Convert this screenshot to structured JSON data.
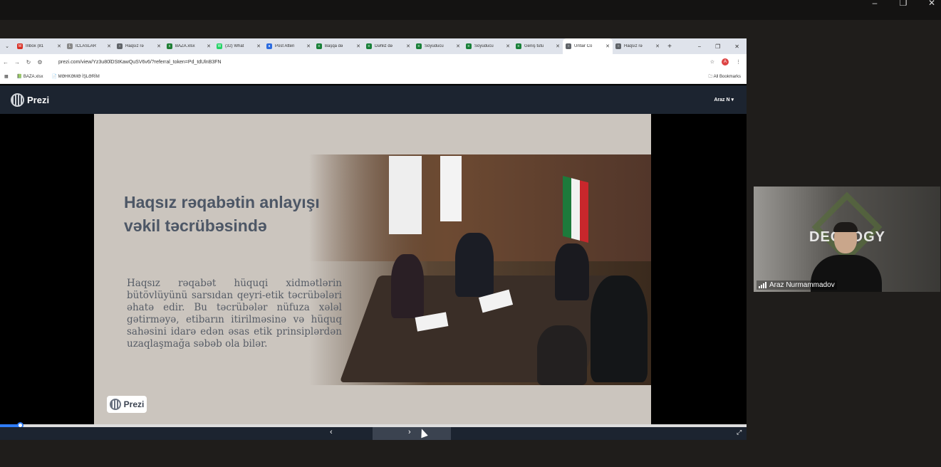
{
  "browser": {
    "tabs": [
      {
        "label": "Inbox (81",
        "color": "#d93025",
        "glyph": "M"
      },
      {
        "label": "İCLASLAR",
        "color": "#888888",
        "glyph": "L"
      },
      {
        "label": "Haqsız rə",
        "color": "#5f6368",
        "glyph": "○"
      },
      {
        "label": "BAZA.xlsx",
        "color": "#1e7e34",
        "glyph": "x"
      },
      {
        "label": "(32) What",
        "color": "#25d366",
        "glyph": "W"
      },
      {
        "label": "Post Atten",
        "color": "#2d6cdf",
        "glyph": "●"
      },
      {
        "label": "Başqa də",
        "color": "#188038",
        "glyph": "≡"
      },
      {
        "label": "Dəhliz də",
        "color": "#188038",
        "glyph": "≡"
      },
      {
        "label": "Soyuducu",
        "color": "#188038",
        "glyph": "≡"
      },
      {
        "label": "Soyuducu",
        "color": "#188038",
        "glyph": "≡"
      },
      {
        "label": "Geniş tutu",
        "color": "#188038",
        "glyph": "≡"
      },
      {
        "label": "Unfair Co",
        "color": "#5f6368",
        "glyph": "○",
        "active": true
      },
      {
        "label": "Haqsız rə",
        "color": "#5f6368",
        "glyph": "○"
      }
    ],
    "url": "prezi.com/view/Yz3u80lDStKawQuSV6v6/?referral_token=Pd_tdUlnB3FN",
    "bookmarks": [
      "BAZA.xlsx",
      "MƏHKƏMƏ İŞLƏRİM"
    ],
    "all_bookmarks": "All Bookmarks",
    "profile_initial": "A"
  },
  "prezi": {
    "logo_text": "Prezi",
    "user": "Araz N",
    "slide": {
      "title": "Haqsız rəqabətin anlayışı vəkil təcrübəsində",
      "body": "Haqsız rəqabət hüquqi xidmətlərin bütövlüyünü sarsıdan qeyri-etik təcrübələri əhatə edir. Bu təcrübələr nüfuza xələl gətirməyə, etibarın itirilməsinə və hüquq sahəsini idarə edən əsas etik prinsiplərdən uzaqlaşmağa səbəb ola bilər.",
      "badge": "Prezi"
    },
    "progress": 0.027
  },
  "participant": {
    "name": "Araz Nurmammadov",
    "background_text": "DEOLOGY"
  }
}
